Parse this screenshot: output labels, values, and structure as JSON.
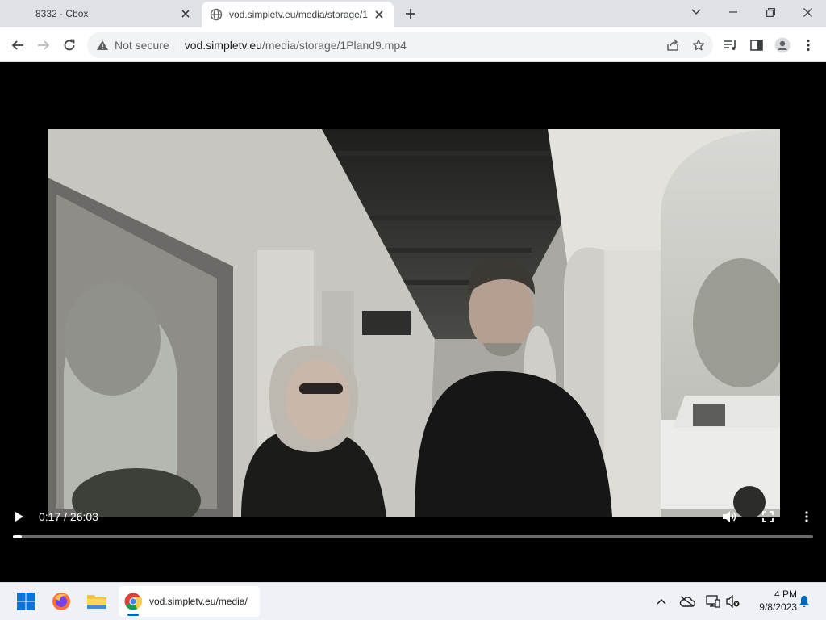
{
  "browser": {
    "tabs": [
      {
        "title": "8332 · Cbox",
        "active": false
      },
      {
        "title": "vod.simpletv.eu/media/storage/1",
        "active": true
      }
    ],
    "omnibox": {
      "security": "Not secure",
      "url_host": "vod.simpletv.eu",
      "url_path": "/media/storage/1Pland9.mp4"
    }
  },
  "video": {
    "current_time": "0:17",
    "duration": "26:03",
    "time_display": "0:17 / 26:03",
    "progress_fraction": 0.011,
    "background_color": "#000000"
  },
  "taskbar": {
    "chrome_label": "vod.simpletv.eu/media/",
    "time": "4 PM",
    "date": "9/8/2023"
  },
  "colors": {
    "tabstrip": "#dee1e6",
    "toolbar": "#ffffff",
    "omnibox": "#f1f3f4",
    "taskbar": "#eef1f6",
    "accent": "#0067c0"
  },
  "icons": {
    "tab_favicon": "globe-icon",
    "play": "play-icon",
    "volume": "volume-icon",
    "fullscreen": "fullscreen-icon",
    "more": "more-vert-icon"
  }
}
